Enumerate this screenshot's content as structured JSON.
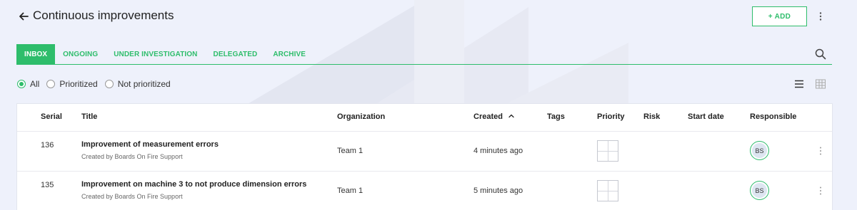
{
  "header": {
    "title": "Continuous improvements",
    "add_label": "+ ADD"
  },
  "tabs": [
    {
      "label": "INBOX",
      "active": true
    },
    {
      "label": "ONGOING",
      "active": false
    },
    {
      "label": "UNDER INVESTIGATION",
      "active": false
    },
    {
      "label": "DELEGATED",
      "active": false
    },
    {
      "label": "ARCHIVE",
      "active": false
    }
  ],
  "filters": [
    {
      "label": "All",
      "checked": true
    },
    {
      "label": "Prioritized",
      "checked": false
    },
    {
      "label": "Not prioritized",
      "checked": false
    }
  ],
  "table": {
    "columns": {
      "serial": "Serial",
      "title": "Title",
      "organization": "Organization",
      "created": "Created",
      "tags": "Tags",
      "priority": "Priority",
      "risk": "Risk",
      "start_date": "Start date",
      "responsible": "Responsible"
    },
    "rows": [
      {
        "serial": "136",
        "title": "Improvement of measurement errors",
        "created_by": "Created by Boards On Fire Support",
        "organization": "Team 1",
        "created": "4 minutes ago",
        "tags": "",
        "risk": "",
        "start_date": "",
        "responsible": "BS"
      },
      {
        "serial": "135",
        "title": "Improvement on machine 3 to not produce dimension errors",
        "created_by": "Created by Boards On Fire Support",
        "organization": "Team 1",
        "created": "5 minutes ago",
        "tags": "",
        "risk": "",
        "start_date": "",
        "responsible": "BS"
      }
    ]
  },
  "colors": {
    "accent": "#2ebd6b",
    "background": "#eef1fb"
  },
  "icons": {
    "back": "arrow-left-icon",
    "menu": "kebab-menu-icon",
    "search": "search-icon",
    "list_view": "list-view-icon",
    "grid_view": "grid-view-icon",
    "sort": "chevron-up-icon"
  }
}
